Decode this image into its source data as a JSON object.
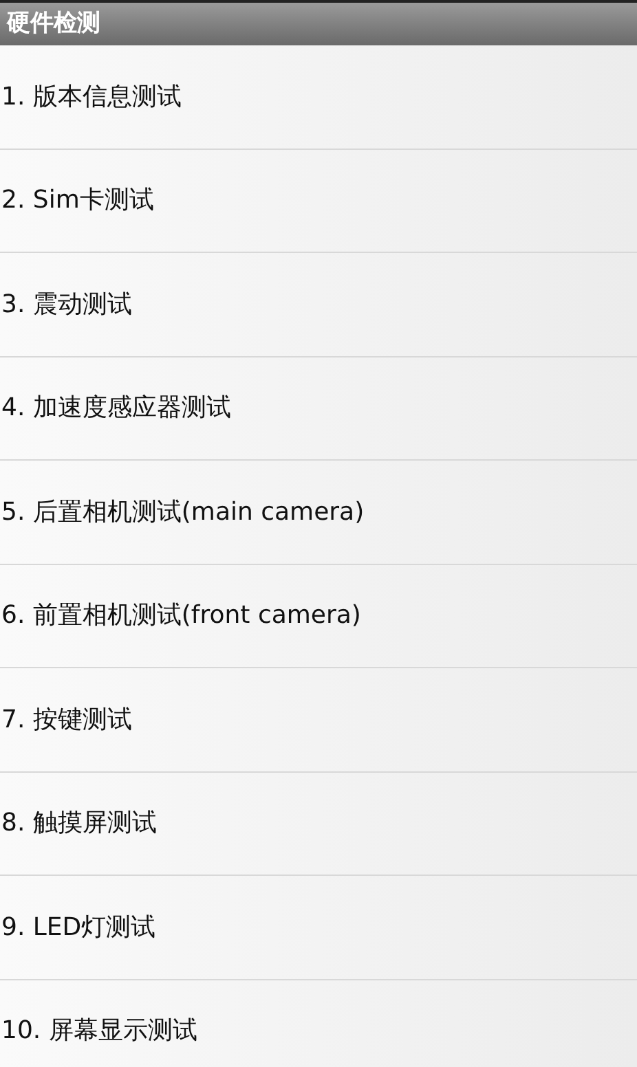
{
  "window": {
    "title": "硬件检测"
  },
  "items": [
    {
      "label": "1. 版本信息测试"
    },
    {
      "label": "2. Sim卡测试"
    },
    {
      "label": "3. 震动测试"
    },
    {
      "label": "4. 加速度感应器测试"
    },
    {
      "label": "5. 后置相机测试(main camera)"
    },
    {
      "label": "6. 前置相机测试(front camera)"
    },
    {
      "label": "7. 按键测试"
    },
    {
      "label": "8. 触摸屏测试"
    },
    {
      "label": "9. LED灯测试"
    },
    {
      "label": "10. 屏幕显示测试"
    }
  ]
}
